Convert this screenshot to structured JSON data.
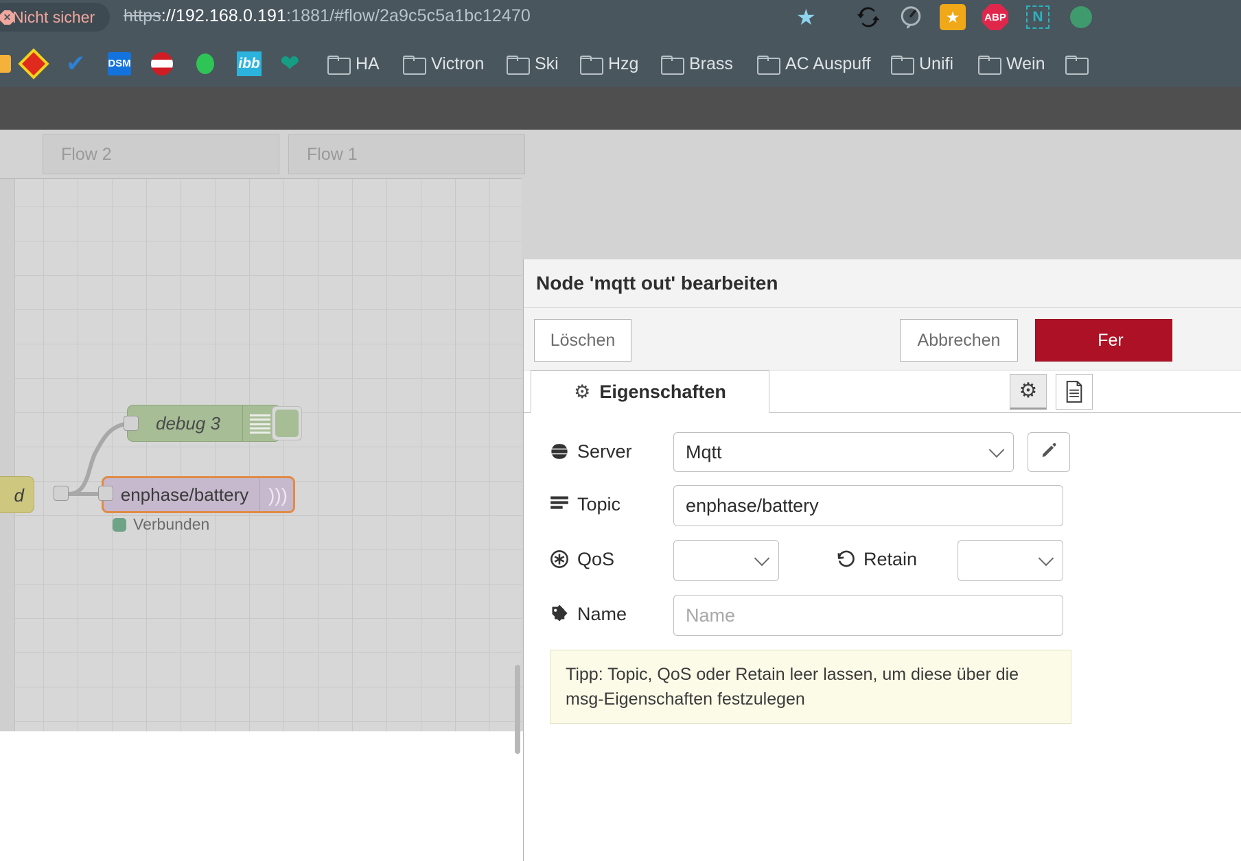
{
  "browser": {
    "security_chip": {
      "label": "Nicht sicher",
      "icon": "warning-octagon-icon"
    },
    "url": {
      "scheme": "https",
      "separator": "://",
      "host": "192.168.0.191",
      "rest": ":1881/#flow/2a9c5c5a1bc12470",
      "full": "https://192.168.0.191:1881/#flow/2a9c5c5a1bc12470"
    },
    "star_icon": "bookmark-star-icon",
    "extensions": [
      {
        "name": "sync-icon",
        "glyph": "↻"
      },
      {
        "name": "speedometer-icon",
        "glyph": "◔"
      },
      {
        "name": "star-orange-icon",
        "glyph": "★"
      },
      {
        "name": "adblock-plus-icon",
        "label": "ABP"
      },
      {
        "name": "notion-clipper-icon",
        "label": "N"
      }
    ],
    "bookmarks": [
      {
        "label": "",
        "icon": "fritz-icon"
      },
      {
        "label": "",
        "icon": "checkmark-icon"
      },
      {
        "label": "",
        "icon": "dsm-icon"
      },
      {
        "label": "",
        "icon": "austria-flag-icon"
      },
      {
        "label": "",
        "icon": "green-dot-icon"
      },
      {
        "label": "",
        "icon": "ibb-icon"
      },
      {
        "label": "",
        "icon": "heart-icon"
      },
      {
        "label": "HA",
        "icon": "folder-icon"
      },
      {
        "label": "Victron",
        "icon": "folder-icon"
      },
      {
        "label": "Ski",
        "icon": "folder-icon"
      },
      {
        "label": "Hzg",
        "icon": "folder-icon"
      },
      {
        "label": "Brass",
        "icon": "folder-icon"
      },
      {
        "label": "AC Auspuff",
        "icon": "folder-icon"
      },
      {
        "label": "Unifi",
        "icon": "folder-icon"
      },
      {
        "label": "Wein",
        "icon": "folder-icon"
      }
    ]
  },
  "workspace": {
    "tabs": [
      {
        "label": "Flow 2"
      },
      {
        "label": "Flow 1"
      }
    ],
    "nodes": {
      "debug": {
        "label": "debug 3",
        "icon": "debug-list-icon"
      },
      "mqtt": {
        "label": "enphase/battery",
        "icon": "mqtt-wifi-icon"
      },
      "inject": {
        "label": "d"
      }
    },
    "status": {
      "label": "Verbunden",
      "color": "#6fa387"
    }
  },
  "dialog": {
    "title": "Node 'mqtt out' bearbeiten",
    "buttons": {
      "delete": "Löschen",
      "cancel": "Abbrechen",
      "done": "Fer"
    },
    "tabs": [
      {
        "label": "Eigenschaften",
        "icon": "gear-icon",
        "active": true
      }
    ],
    "tools": [
      {
        "name": "gear-icon",
        "active": true
      },
      {
        "name": "document-icon",
        "active": false
      }
    ],
    "form": {
      "server": {
        "label": "Server",
        "icon": "globe-icon",
        "value": "Mqtt",
        "edit_icon": "pencil-icon"
      },
      "topic": {
        "label": "Topic",
        "icon": "list-icon",
        "value": "enphase/battery"
      },
      "qos": {
        "label": "QoS",
        "icon": "asterisk-circle-icon",
        "value": ""
      },
      "retain": {
        "label": "Retain",
        "icon": "history-icon",
        "value": ""
      },
      "name": {
        "label": "Name",
        "icon": "tag-icon",
        "value": "",
        "placeholder": "Name"
      }
    },
    "tip": "Tipp: Topic, QoS oder Retain leer lassen, um diese über die msg-Eigenschaften festzulegen"
  },
  "colors": {
    "chrome_bg": "#49565e",
    "insecure_red": "#f2a79e",
    "done_button": "#ad1125",
    "node_debug": "#a6bd96",
    "node_mqtt": "#c6b9cd",
    "node_mqtt_border": "#e08b45",
    "node_inject": "#cdc77f",
    "status_green": "#6fa387",
    "tip_bg": "#fbfbe8"
  }
}
